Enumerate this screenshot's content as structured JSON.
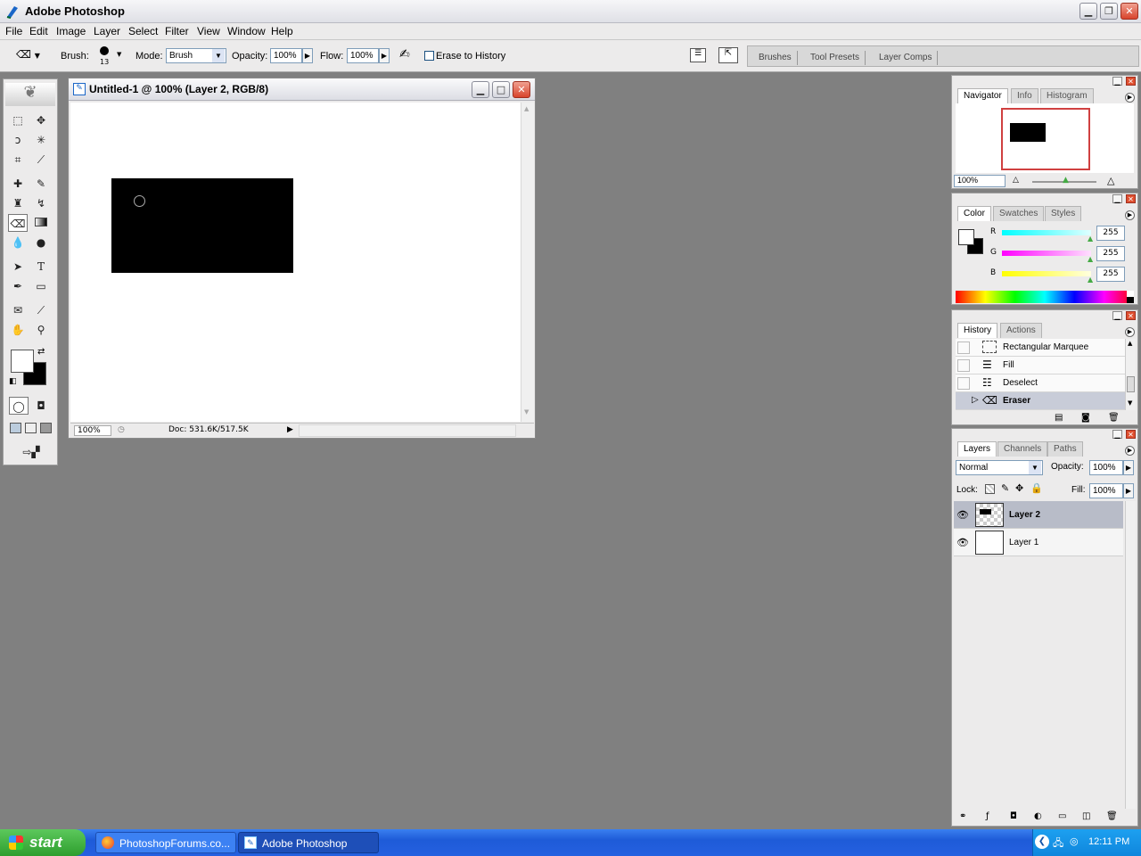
{
  "app": {
    "title": "Adobe Photoshop"
  },
  "menu": [
    "File",
    "Edit",
    "Image",
    "Layer",
    "Select",
    "Filter",
    "View",
    "Window",
    "Help"
  ],
  "options": {
    "brush_label": "Brush:",
    "brush_size": "13",
    "mode_label": "Mode:",
    "mode_value": "Brush",
    "opacity_label": "Opacity:",
    "opacity_value": "100%",
    "flow_label": "Flow:",
    "flow_value": "100%",
    "erase_history_label": "Erase to History",
    "well_tabs": [
      "Brushes",
      "Tool Presets",
      "Layer Comps"
    ]
  },
  "document": {
    "title": "Untitled-1 @ 100% (Layer 2, RGB/8)",
    "zoom": "100%",
    "doc_info": "Doc: 531.6K/517.5K"
  },
  "navigator": {
    "tabs": [
      "Navigator",
      "Info",
      "Histogram"
    ],
    "zoom": "100%"
  },
  "color": {
    "tabs": [
      "Color",
      "Swatches",
      "Styles"
    ],
    "channels": [
      {
        "label": "R",
        "value": "255",
        "gradient": "#00ffff"
      },
      {
        "label": "G",
        "value": "255",
        "gradient": "#ff00ff"
      },
      {
        "label": "B",
        "value": "255",
        "gradient": "#ffff00"
      }
    ]
  },
  "history": {
    "tabs": [
      "History",
      "Actions"
    ],
    "items": [
      "Rectangular Marquee",
      "Fill",
      "Deselect",
      "Eraser"
    ]
  },
  "layers": {
    "tabs": [
      "Layers",
      "Channels",
      "Paths"
    ],
    "blend_mode": "Normal",
    "opacity_label": "Opacity:",
    "opacity_value": "100%",
    "lock_label": "Lock:",
    "fill_label": "Fill:",
    "fill_value": "100%",
    "items": [
      "Layer 2",
      "Layer 1"
    ]
  },
  "taskbar": {
    "start": "start",
    "items": [
      "PhotoshopForums.co...",
      "Adobe Photoshop"
    ],
    "clock": "12:11 PM"
  }
}
